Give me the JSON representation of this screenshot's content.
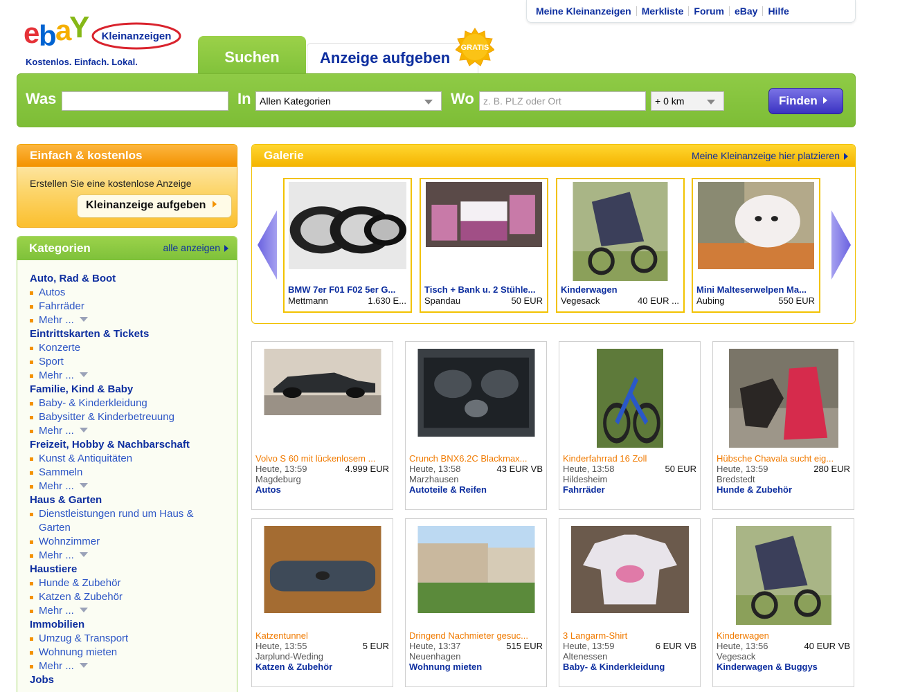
{
  "topnav": [
    "Meine Kleinanzeigen",
    "Merkliste",
    "Forum",
    "eBay",
    "Hilfe"
  ],
  "logo": {
    "brand": "ebay",
    "sub": "Kleinanzeigen"
  },
  "tagline": "Kostenlos. Einfach. Lokal.",
  "tabs": {
    "search": "Suchen",
    "post": "Anzeige aufgeben",
    "badge": "GRATIS"
  },
  "search": {
    "what_label": "Was",
    "what_value": "",
    "in_label": "In",
    "category_value": "Allen Kategorien",
    "where_label": "Wo",
    "where_placeholder": "z. B. PLZ oder Ort",
    "radius_value": "+ 0 km",
    "find_label": "Finden"
  },
  "promo": {
    "title": "Einfach & kostenlos",
    "text": "Erstellen Sie eine kostenlose Anzeige",
    "button": "Kleinanzeige aufgeben"
  },
  "categories": {
    "title": "Kategorien",
    "show_all": "alle anzeigen",
    "groups": [
      {
        "title": "Auto, Rad & Boot",
        "items": [
          "Autos",
          "Fahrräder",
          "Mehr ..."
        ]
      },
      {
        "title": "Eintrittskarten & Tickets",
        "items": [
          "Konzerte",
          "Sport",
          "Mehr ..."
        ]
      },
      {
        "title": "Familie, Kind & Baby",
        "items": [
          "Baby- & Kinderkleidung",
          "Babysitter & Kinderbetreuung",
          "Mehr ..."
        ]
      },
      {
        "title": "Freizeit, Hobby & Nachbarschaft",
        "items": [
          "Kunst & Antiquitäten",
          "Sammeln",
          "Mehr ..."
        ]
      },
      {
        "title": "Haus & Garten",
        "items": [
          "Dienstleistungen rund um Haus & Garten",
          "Wohnzimmer",
          "Mehr ..."
        ]
      },
      {
        "title": "Haustiere",
        "items": [
          "Hunde & Zubehör",
          "Katzen & Zubehör",
          "Mehr ..."
        ]
      },
      {
        "title": "Immobilien",
        "items": [
          "Umzug & Transport",
          "Wohnung mieten",
          "Mehr ..."
        ]
      },
      {
        "title": "Jobs",
        "items": []
      }
    ]
  },
  "gallery": {
    "title": "Galerie",
    "place_link": "Meine Kleinanzeige hier platzieren",
    "items": [
      {
        "title": "BMW 7er F01 F02 5er G...",
        "location": "Mettmann",
        "price": "1.630 E...",
        "image": "wheels"
      },
      {
        "title": "Tisch + Bank u. 2 Stühle...",
        "location": "Spandau",
        "price": "50 EUR",
        "image": "table"
      },
      {
        "title": "Kinderwagen",
        "location": "Vegesack",
        "price": "40 EUR ...",
        "image": "stroller"
      },
      {
        "title": "Mini Malteserwelpen Ma...",
        "location": "Aubing",
        "price": "550 EUR",
        "image": "puppy"
      }
    ]
  },
  "listings": [
    {
      "title": "Volvo S 60 mit lückenlosem ...",
      "time": "Heute, 13:59",
      "price": "4.999 EUR",
      "location": "Magdeburg",
      "category": "Autos",
      "image": "car"
    },
    {
      "title": "Crunch BNX6.2C Blackmax...",
      "time": "Heute, 13:58",
      "price": "43 EUR VB",
      "location": "Marzhausen",
      "category": "Autoteile & Reifen",
      "image": "speakers"
    },
    {
      "title": "Kinderfahrrad 16 Zoll",
      "time": "Heute, 13:58",
      "price": "50 EUR",
      "location": "Hildesheim",
      "category": "Fahrräder",
      "image": "bike"
    },
    {
      "title": "Hübsche Chavala sucht eig...",
      "time": "Heute, 13:59",
      "price": "280 EUR",
      "location": "Bredstedt",
      "category": "Hunde & Zubehör",
      "image": "dog"
    },
    {
      "title": "Katzentunnel",
      "time": "Heute, 13:55",
      "price": "5 EUR",
      "location": "Jarplund-Weding",
      "category": "Katzen & Zubehör",
      "image": "tunnel"
    },
    {
      "title": "Dringend Nachmieter gesuc...",
      "time": "Heute, 13:37",
      "price": "515 EUR",
      "location": "Neuenhagen",
      "category": "Wohnung mieten",
      "image": "building"
    },
    {
      "title": "3 Langarm-Shirt",
      "time": "Heute, 13:59",
      "price": "6 EUR VB",
      "location": "Altenessen",
      "category": "Baby- & Kinderkleidung",
      "image": "shirt"
    },
    {
      "title": "Kinderwagen",
      "time": "Heute, 13:56",
      "price": "40 EUR VB",
      "location": "Vegesack",
      "category": "Kinderwagen & Buggys",
      "image": "stroller"
    }
  ],
  "colors": {
    "green": "#80c13a",
    "orange": "#f39200",
    "yellow": "#f4b400",
    "link": "#0d2e9f",
    "title_orange": "#f07a00"
  }
}
